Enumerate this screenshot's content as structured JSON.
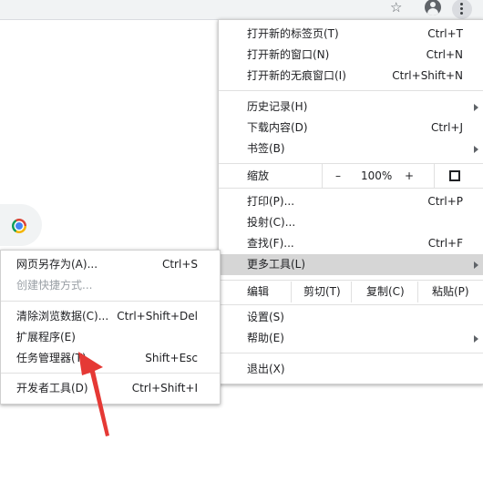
{
  "main_menu": {
    "new_tab": {
      "label": "打开新的标签页(T)",
      "shortcut": "Ctrl+T"
    },
    "new_window": {
      "label": "打开新的窗口(N)",
      "shortcut": "Ctrl+N"
    },
    "new_incognito": {
      "label": "打开新的无痕窗口(I)",
      "shortcut": "Ctrl+Shift+N"
    },
    "history": {
      "label": "历史记录(H)"
    },
    "downloads": {
      "label": "下载内容(D)",
      "shortcut": "Ctrl+J"
    },
    "bookmarks": {
      "label": "书签(B)"
    },
    "zoom": {
      "label": "缩放",
      "minus": "–",
      "value": "100%",
      "plus": "+"
    },
    "print": {
      "label": "打印(P)...",
      "shortcut": "Ctrl+P"
    },
    "cast": {
      "label": "投射(C)..."
    },
    "find": {
      "label": "查找(F)...",
      "shortcut": "Ctrl+F"
    },
    "more_tools": {
      "label": "更多工具(L)"
    },
    "edit": {
      "label": "编辑",
      "cut": "剪切(T)",
      "copy": "复制(C)",
      "paste": "粘贴(P)"
    },
    "settings": {
      "label": "设置(S)"
    },
    "help": {
      "label": "帮助(E)"
    },
    "exit": {
      "label": "退出(X)"
    }
  },
  "sub_menu": {
    "save_page": {
      "label": "网页另存为(A)...",
      "shortcut": "Ctrl+S"
    },
    "create_shortcut": {
      "label": "创建快捷方式..."
    },
    "clear_data": {
      "label": "清除浏览数据(C)...",
      "shortcut": "Ctrl+Shift+Del"
    },
    "extensions": {
      "label": "扩展程序(E)"
    },
    "task_manager": {
      "label": "任务管理器(T)",
      "shortcut": "Shift+Esc"
    },
    "dev_tools": {
      "label": "开发者工具(D)",
      "shortcut": "Ctrl+Shift+I"
    }
  },
  "colors": {
    "highlight": "#d6d6d6",
    "annotation_arrow": "#e53935",
    "topbar": "#f1f3f4"
  },
  "icons": [
    "star-icon",
    "profile-icon",
    "more-vert-icon",
    "chrome-logo-icon",
    "fullscreen-icon",
    "submenu-arrow-icon"
  ]
}
